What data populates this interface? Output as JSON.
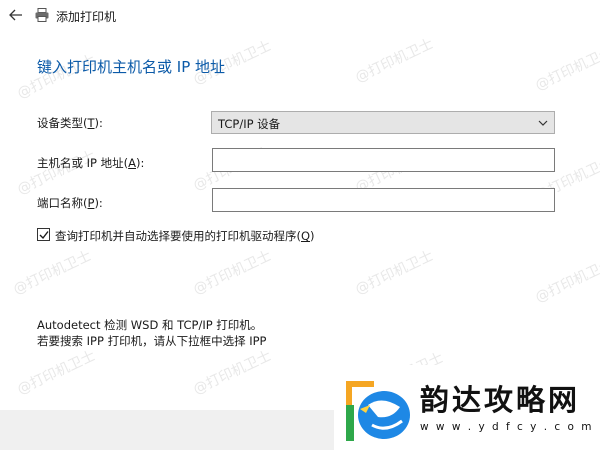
{
  "window": {
    "title": "添加打印机"
  },
  "heading": "键入打印机主机名或 IP 地址",
  "form": {
    "device_type": {
      "label_pre": "设备类型(",
      "label_key": "T",
      "label_post": "):",
      "value": "TCP/IP 设备"
    },
    "hostname": {
      "label_pre": "主机名或 IP 地址(",
      "label_key": "A",
      "label_post": "):",
      "value": ""
    },
    "port_name": {
      "label_pre": "端口名称(",
      "label_key": "P",
      "label_post": "):",
      "value": ""
    },
    "query_checkbox": {
      "checked": true,
      "label_pre": "查询打印机并自动选择要使用的打印机驱动程序(",
      "label_key": "Q",
      "label_post": ")"
    }
  },
  "info": {
    "line1": "Autodetect 检测 WSD 和 TCP/IP 打印机。",
    "line2": "若要搜索 IPP 打印机，请从下拉框中选择 IPP"
  },
  "watermark_text": "@打印机卫士",
  "logo": {
    "name": "韵达攻略网",
    "url": "w w w . y d f c y . c o m"
  },
  "colors": {
    "heading": "#0b5aa8",
    "footer": "#f0f0f0",
    "select_bg": "#e5e5e5"
  },
  "icons": {
    "back": "back-arrow-icon",
    "printer": "printer-icon",
    "dropdown": "chevron-down-icon",
    "check": "check-icon"
  }
}
